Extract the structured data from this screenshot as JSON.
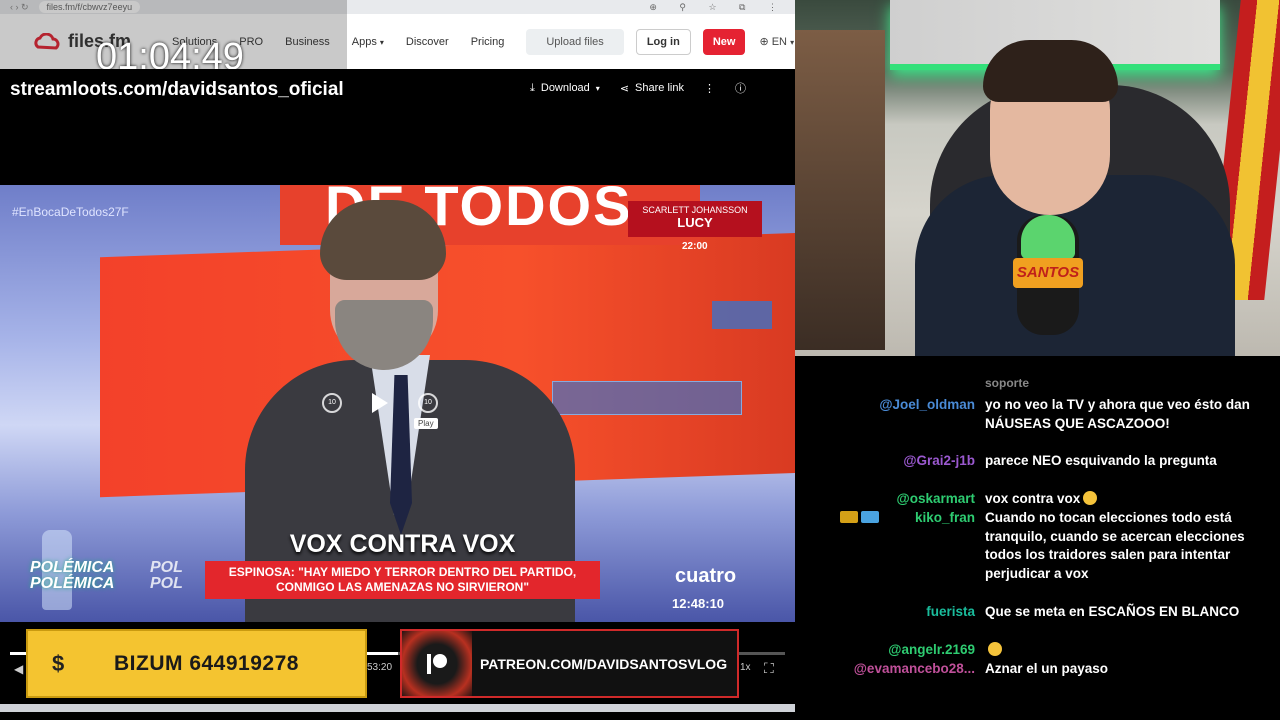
{
  "browser": {
    "url": "files.fm/f/cbwvz7eeyu",
    "nav_glyphs": "‹ › ↻",
    "toolbar_glyphs": "⊕ ⚲ ☆ ⧉ ⋮"
  },
  "site": {
    "logo": "files.fm",
    "nav": [
      "Solutions",
      "PRO",
      "Business",
      "Apps",
      "Discover",
      "Pricing"
    ],
    "upload_label": "Upload files",
    "login_label": "Log in",
    "new_label": "New",
    "lang_label": "EN"
  },
  "overlay": {
    "timer": "01:04:49",
    "stream_url": "streamloots.com/davidsantos_oficial"
  },
  "player": {
    "download_label": "Download",
    "share_label": "Share link",
    "play_tooltip": "Play",
    "time_display": "53:20",
    "speed_label": "1x",
    "skip_back": "10",
    "skip_fwd": "10",
    "progress": 0.5
  },
  "tv": {
    "banner": "DE TODOS",
    "hashtag": "#EnBocaDeTodos27F",
    "promo_top": "SCARLETT JOHANSSON",
    "promo_title": "LUCY",
    "promo_time": "22:00",
    "headline": "VOX CONTRA VOX",
    "subheadline": "ESPINOSA: \"HAY MIEDO Y TERROR DENTRO DEL PARTIDO, CONMIGO LAS AMENAZAS NO SIRVIERON\"",
    "tag1": "POLÉMICA",
    "tag2": "POLÉMICA",
    "tag3": "POL",
    "channel": "cuatro",
    "clock": "12:48:10"
  },
  "donations": {
    "bizum_icon": "$",
    "bizum": "BIZUM 644919278",
    "patreon": "PATREON.COM/DAVIDSANTOSVLOG"
  },
  "webcam": {
    "mic_brand": "SANTOS"
  },
  "chat": {
    "cutoff": "soporte",
    "messages": [
      {
        "user": "@Joel_oldman",
        "color": "#4a8bd6",
        "text": "yo no veo la TV y ahora que veo ésto dan NÁUSEAS QUE ASCAZOOO!"
      },
      {
        "user": "@Grai2-j1b",
        "color": "#9b59d0",
        "text": "parece NEO esquivando la pregunta"
      },
      {
        "user": "@oskarmart",
        "color": "#2ecc71",
        "text": "vox contra vox"
      },
      {
        "user": "kiko_fran",
        "color": "#2ecc71",
        "text": "Cuando no tocan elecciones todo está tranquilo, cuando se acercan elecciones todos los traidores salen para intentar perjudicar a vox"
      },
      {
        "user": "fuerista",
        "color": "#1abc9c",
        "text": "Que se meta en ESCAÑOS EN BLANCO"
      },
      {
        "user": "@angelr.2169",
        "color": "#2ecc71",
        "text": ""
      },
      {
        "user": "@evamancebo28...",
        "color": "#c0509a",
        "text": "Aznar el un payaso"
      }
    ]
  }
}
